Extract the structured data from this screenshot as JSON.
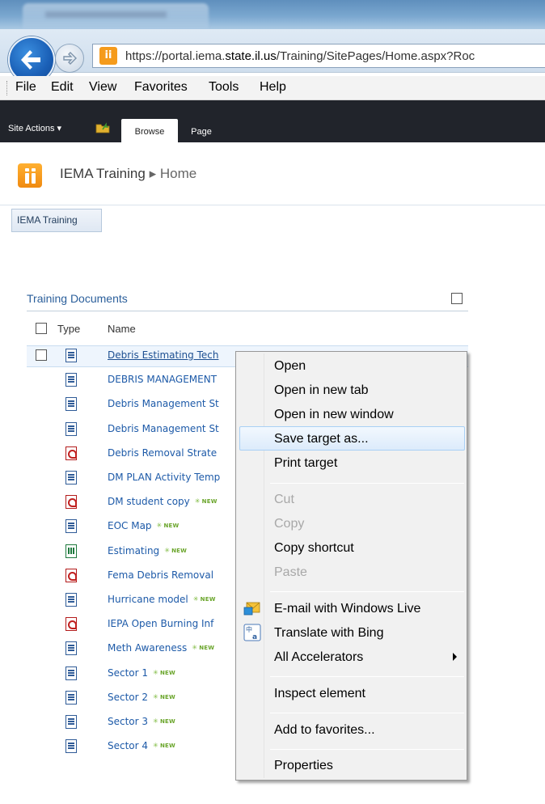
{
  "browser": {
    "url_prefix": "https://portal.iema.",
    "url_host": "state.il.us",
    "url_path": "/Training/SitePages/Home.aspx?Roc",
    "menu": [
      "File",
      "Edit",
      "View",
      "Favorites",
      "Tools",
      "Help"
    ]
  },
  "ribbon": {
    "site_actions": "Site Actions ▾",
    "tabs": [
      "Browse",
      "Page"
    ]
  },
  "site": {
    "title": "IEMA Training",
    "separator": "▸",
    "current_page": "Home",
    "topnav": "IEMA Training"
  },
  "list": {
    "title": "Training Documents",
    "col_type": "Type",
    "col_name": "Name",
    "new_label": "NEW",
    "rows": [
      {
        "name": "Debris Estimating Tech",
        "kind": "word",
        "new": false
      },
      {
        "name": "DEBRIS MANAGEMENT",
        "kind": "word",
        "new": false
      },
      {
        "name": "Debris Management St",
        "kind": "word",
        "new": false
      },
      {
        "name": "Debris Management St",
        "kind": "word",
        "new": false
      },
      {
        "name": "Debris Removal Strate",
        "kind": "pdf",
        "new": false
      },
      {
        "name": "DM PLAN Activity Temp",
        "kind": "word",
        "new": false
      },
      {
        "name": "DM student copy",
        "kind": "pdf",
        "new": true
      },
      {
        "name": "EOC Map",
        "kind": "word",
        "new": true
      },
      {
        "name": "Estimating",
        "kind": "excel",
        "new": true
      },
      {
        "name": "Fema Debris Removal",
        "kind": "pdf",
        "new": false
      },
      {
        "name": "Hurricane model",
        "kind": "word",
        "new": true
      },
      {
        "name": "IEPA Open Burning Inf",
        "kind": "pdf",
        "new": false
      },
      {
        "name": "Meth Awareness",
        "kind": "word",
        "new": true
      },
      {
        "name": "Sector 1",
        "kind": "word",
        "new": true
      },
      {
        "name": "Sector 2",
        "kind": "word",
        "new": true
      },
      {
        "name": "Sector 3",
        "kind": "word",
        "new": true
      },
      {
        "name": "Sector 4",
        "kind": "word",
        "new": true
      }
    ]
  },
  "context_menu": {
    "items": [
      {
        "label": "Open",
        "disabled": false
      },
      {
        "label": "Open in new tab",
        "disabled": false
      },
      {
        "label": "Open in new window",
        "disabled": false
      },
      {
        "label": "Save target as...",
        "disabled": false,
        "highlighted": true
      },
      {
        "label": "Print target",
        "disabled": false
      },
      {
        "label": "Cut",
        "disabled": true
      },
      {
        "label": "Copy",
        "disabled": true
      },
      {
        "label": "Copy shortcut",
        "disabled": false
      },
      {
        "label": "Paste",
        "disabled": true
      },
      {
        "label": "E-mail with Windows Live",
        "disabled": false,
        "icon": "windows-live-mail-icon"
      },
      {
        "label": "Translate with Bing",
        "disabled": false,
        "icon": "bing-translate-icon"
      },
      {
        "label": "All Accelerators",
        "disabled": false,
        "submenu": true
      },
      {
        "label": "Inspect element",
        "disabled": false
      },
      {
        "label": "Add to favorites...",
        "disabled": false
      },
      {
        "label": "Properties",
        "disabled": false
      }
    ]
  },
  "colors": {
    "ribbon": "#21242b",
    "link": "#1d5aa8",
    "site_logo": "#f59b1c",
    "new_badge": "#6aa52b"
  }
}
